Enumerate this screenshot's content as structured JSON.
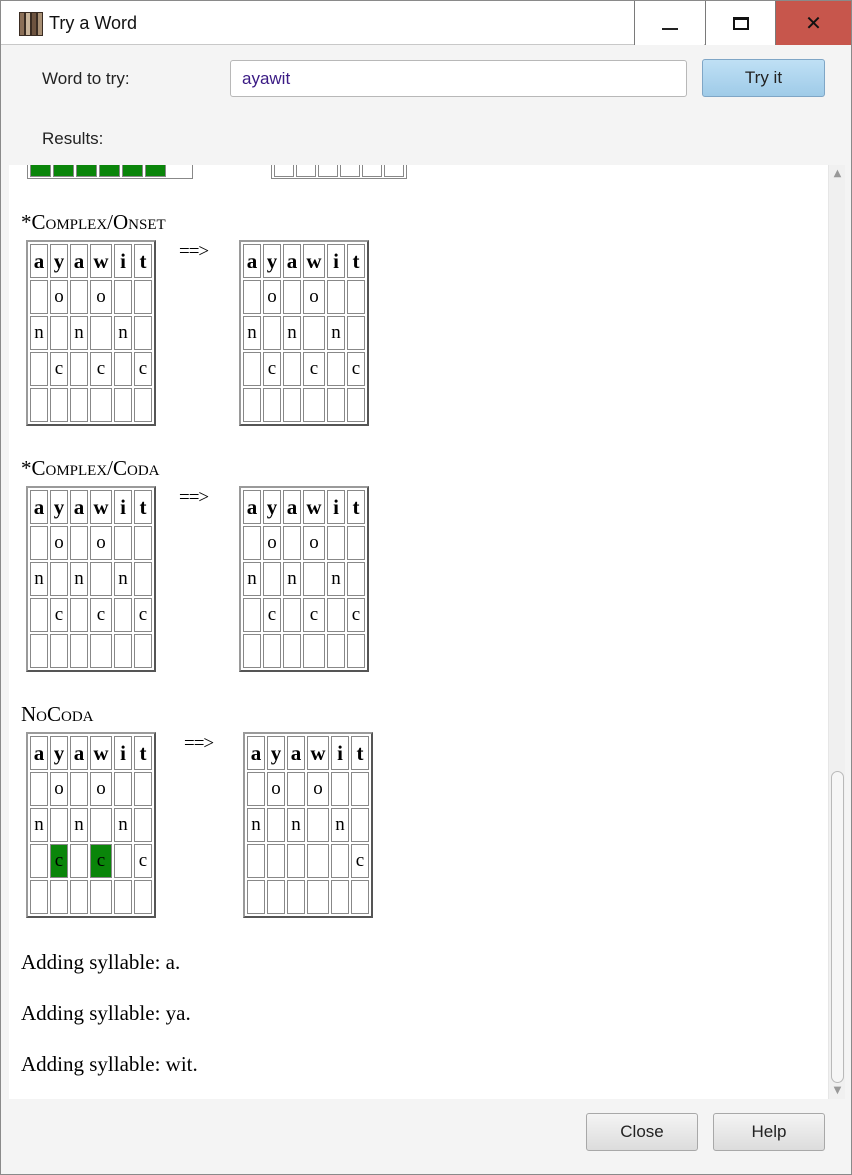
{
  "window": {
    "title": "Try a Word"
  },
  "form": {
    "word_label": "Word to try:",
    "word_value": "ayawit",
    "try_button": "Try it",
    "results_label": "Results:"
  },
  "results": {
    "arrow": "==>",
    "sections": [
      {
        "heading": "*Complex/Onset",
        "before": {
          "header": [
            "a",
            "y",
            "a",
            "w",
            "i",
            "t"
          ],
          "rows": [
            [
              "",
              "o",
              "",
              "o",
              "",
              ""
            ],
            [
              "n",
              "",
              "n",
              "",
              "n",
              ""
            ],
            [
              "",
              "c",
              "",
              "c",
              "",
              "c"
            ],
            [
              "",
              "",
              "",
              "",
              "",
              ""
            ]
          ],
          "highlighted": []
        },
        "after": {
          "header": [
            "a",
            "y",
            "a",
            "w",
            "i",
            "t"
          ],
          "rows": [
            [
              "",
              "o",
              "",
              "o",
              "",
              ""
            ],
            [
              "n",
              "",
              "n",
              "",
              "n",
              ""
            ],
            [
              "",
              "c",
              "",
              "c",
              "",
              "c"
            ],
            [
              "",
              "",
              "",
              "",
              "",
              ""
            ]
          ]
        }
      },
      {
        "heading": "*Complex/Coda",
        "before": {
          "header": [
            "a",
            "y",
            "a",
            "w",
            "i",
            "t"
          ],
          "rows": [
            [
              "",
              "o",
              "",
              "o",
              "",
              ""
            ],
            [
              "n",
              "",
              "n",
              "",
              "n",
              ""
            ],
            [
              "",
              "c",
              "",
              "c",
              "",
              "c"
            ],
            [
              "",
              "",
              "",
              "",
              "",
              ""
            ]
          ],
          "highlighted": []
        },
        "after": {
          "header": [
            "a",
            "y",
            "a",
            "w",
            "i",
            "t"
          ],
          "rows": [
            [
              "",
              "o",
              "",
              "o",
              "",
              ""
            ],
            [
              "n",
              "",
              "n",
              "",
              "n",
              ""
            ],
            [
              "",
              "c",
              "",
              "c",
              "",
              "c"
            ],
            [
              "",
              "",
              "",
              "",
              "",
              ""
            ]
          ]
        }
      },
      {
        "heading": "NoCoda",
        "before": {
          "header": [
            "a",
            "y",
            "a",
            "w",
            "i",
            "t"
          ],
          "rows": [
            [
              "",
              "o",
              "",
              "o",
              "",
              ""
            ],
            [
              "n",
              "",
              "n",
              "",
              "n",
              ""
            ],
            [
              "",
              "c",
              "",
              "c",
              "",
              "c"
            ],
            [
              "",
              "",
              "",
              "",
              "",
              ""
            ]
          ],
          "highlighted": [
            [
              2,
              1
            ],
            [
              2,
              3
            ]
          ]
        },
        "after": {
          "header": [
            "a",
            "y",
            "a",
            "w",
            "i",
            "t"
          ],
          "rows": [
            [
              "",
              "o",
              "",
              "o",
              "",
              ""
            ],
            [
              "n",
              "",
              "n",
              "",
              "n",
              ""
            ],
            [
              "",
              "",
              "",
              "",
              "",
              "c"
            ],
            [
              "",
              "",
              "",
              "",
              "",
              ""
            ]
          ]
        }
      }
    ],
    "messages": [
      "Adding syllable: a.",
      "Adding syllable: ya.",
      "Adding syllable: wit."
    ],
    "highlight_color": "#0a850a"
  },
  "footer": {
    "close_button": "Close",
    "help_button": "Help"
  }
}
